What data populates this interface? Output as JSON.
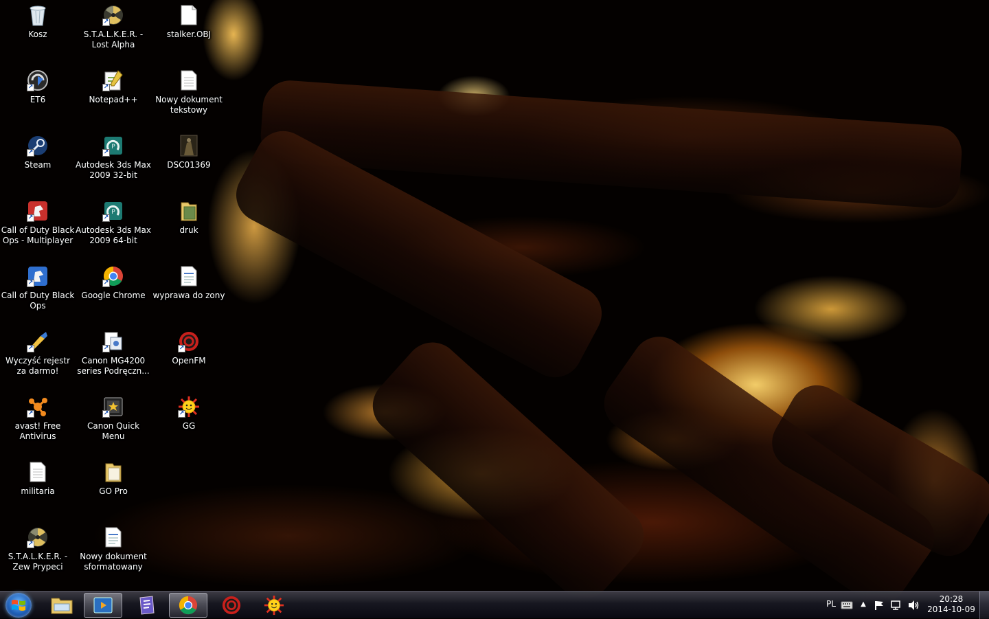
{
  "desktop": {
    "icons": [
      {
        "label": "Kosz"
      },
      {
        "label": "ET6"
      },
      {
        "label": "Steam"
      },
      {
        "label": "Call of Duty Black Ops - Multiplayer"
      },
      {
        "label": "Call of Duty Black Ops"
      },
      {
        "label": "Wyczyść rejestr za darmo!"
      },
      {
        "label": "avast! Free Antivirus"
      },
      {
        "label": "militaria"
      },
      {
        "label": "S.T.A.L.K.E.R. - Zew Prypeci"
      },
      {
        "label": "S.T.A.L.K.E.R. - Lost Alpha"
      },
      {
        "label": "Notepad++"
      },
      {
        "label": "Autodesk 3ds Max 2009 32-bit"
      },
      {
        "label": "Autodesk 3ds Max 2009 64-bit"
      },
      {
        "label": "Google Chrome"
      },
      {
        "label": "Canon MG4200 series Podręczn..."
      },
      {
        "label": "Canon Quick Menu"
      },
      {
        "label": "GO Pro"
      },
      {
        "label": "Nowy dokument sformatowany"
      },
      {
        "label": "stalker.OBJ"
      },
      {
        "label": "Nowy dokument tekstowy"
      },
      {
        "label": "DSC01369"
      },
      {
        "label": "druk"
      },
      {
        "label": "wyprawa do zony"
      },
      {
        "label": "OpenFM"
      },
      {
        "label": "GG"
      }
    ]
  },
  "taskbar": {
    "pinned": [
      {
        "name": "windows-explorer",
        "icon": "folder-icon"
      },
      {
        "name": "media-player",
        "icon": "media-player-icon"
      },
      {
        "name": "app-purple",
        "icon": "document-app-icon"
      },
      {
        "name": "google-chrome",
        "icon": "chrome-icon"
      },
      {
        "name": "openfm",
        "icon": "openfm-icon"
      },
      {
        "name": "gg",
        "icon": "gg-sun-icon"
      }
    ],
    "tray": {
      "language": "PL",
      "time": "20:28",
      "date": "2014-10-09"
    }
  },
  "colors": {
    "accent_blue": "#1e5fb8",
    "text": "#ffffff"
  }
}
